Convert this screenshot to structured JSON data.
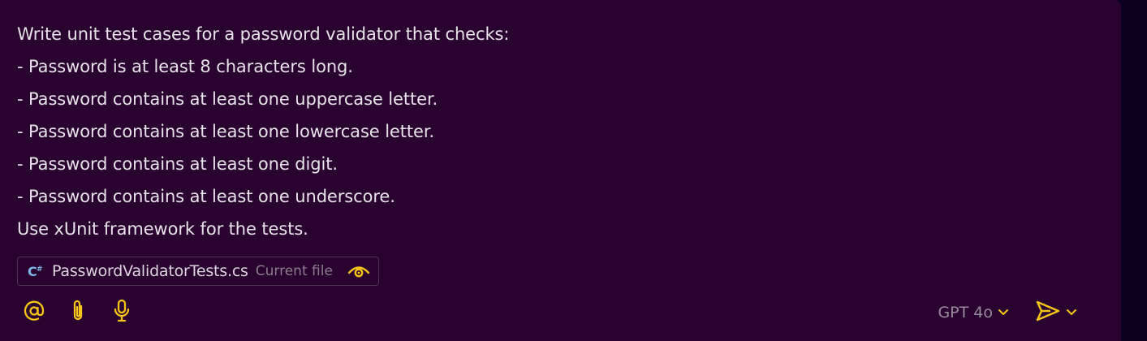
{
  "prompt": {
    "lines": [
      "Write unit test cases for a password validator that checks:",
      "- Password is at least 8 characters long.",
      "- Password contains at least one uppercase letter.",
      "- Password contains at least one lowercase letter.",
      "- Password contains at least one digit.",
      "- Password contains at least one underscore.",
      "Use xUnit framework for the tests."
    ]
  },
  "context_chip": {
    "file_name": "PasswordValidatorTests.cs",
    "tag": "Current file",
    "icon": "csharp-file-icon",
    "toggle_icon": "eye-icon"
  },
  "toolbar": {
    "mention_icon": "at-icon",
    "attach_icon": "paperclip-icon",
    "voice_icon": "microphone-icon",
    "model_label": "GPT 4o",
    "send_icon": "send-icon"
  },
  "colors": {
    "panel_bg": "#2a0230",
    "page_bg": "#0c0020",
    "text": "#e8e2ea",
    "accent": "#f5c518",
    "muted": "#9a8a9e"
  }
}
